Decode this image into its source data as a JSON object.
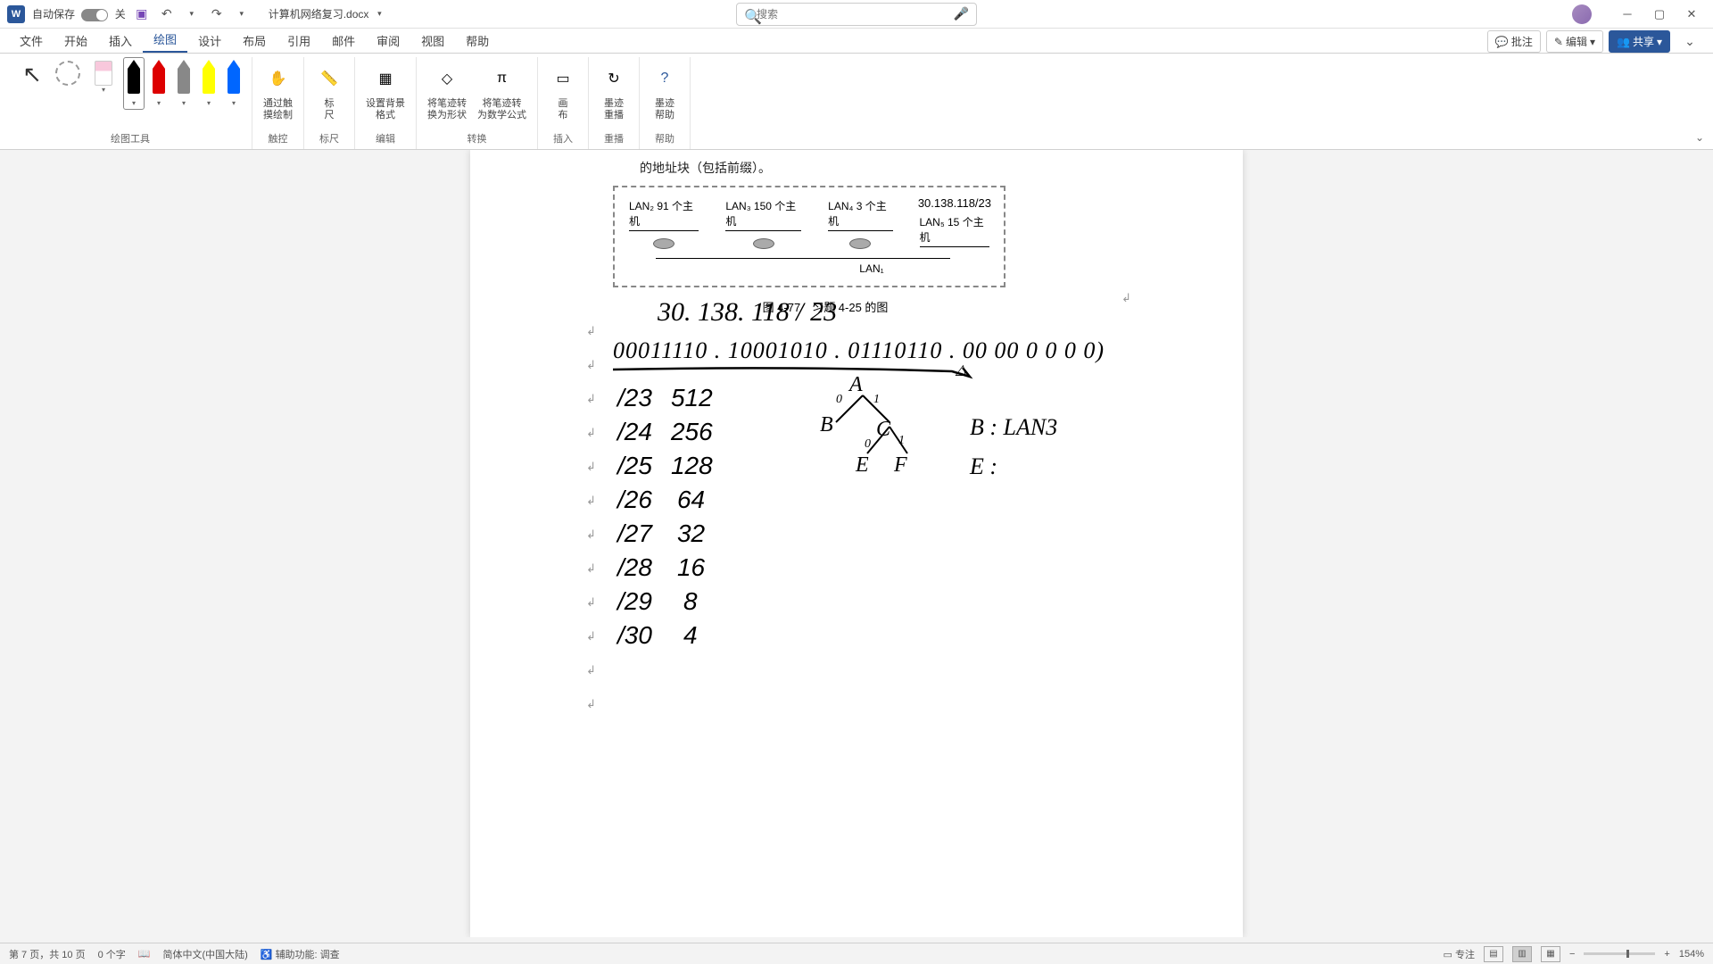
{
  "titlebar": {
    "autosave_label": "自动保存",
    "autosave_state": "关",
    "doc_title": "计算机网络复习.docx",
    "search_placeholder": "搜索"
  },
  "menu": {
    "tabs": [
      "文件",
      "开始",
      "插入",
      "绘图",
      "设计",
      "布局",
      "引用",
      "邮件",
      "审阅",
      "视图",
      "帮助"
    ],
    "active_index": 3,
    "comments": "批注",
    "edit": "编辑",
    "share": "共享"
  },
  "ribbon": {
    "groups": {
      "draw_tools": "绘图工具",
      "touch": "触控",
      "ruler_g": "标尺",
      "edit": "编辑",
      "convert": "转换",
      "insert": "插入",
      "replay": "重播",
      "help": "帮助"
    },
    "buttons": {
      "touch_draw": "通过触\n摸绘制",
      "ruler": "标\n尺",
      "ink_format": "设置背景\n格式",
      "ink_to_shape": "将笔迹转\n换为形状",
      "ink_to_math": "将笔迹转\n为数学公式",
      "canvas": "画\n布",
      "ink_replay": "墨迹\n重播",
      "ink_help": "墨迹\n帮助"
    }
  },
  "document": {
    "intro_text": "的地址块（包括前缀）。",
    "diagram": {
      "ip": "30.138.118/23",
      "lan2": "LAN₂ 91 个主机",
      "lan3": "LAN₃ 150 个主机",
      "lan4": "LAN₄ 3 个主机",
      "lan5": "LAN₅ 15 个主机",
      "lan1": "LAN₁"
    },
    "caption": "图 4-77　习题 4-25 的图",
    "handwriting": {
      "ip_line": "30. 138. 118 / 23",
      "binary": "00011110 . 10001010 . 01110110 . 00 00 0 0 0 0)",
      "prefix_rows": [
        {
          "p": "/23",
          "n": "512"
        },
        {
          "p": "/24",
          "n": "256"
        },
        {
          "p": "/25",
          "n": "128"
        },
        {
          "p": "/26",
          "n": "64"
        },
        {
          "p": "/27",
          "n": "32"
        },
        {
          "p": "/28",
          "n": "16"
        },
        {
          "p": "/29",
          "n": "8"
        },
        {
          "p": "/30",
          "n": "4"
        }
      ],
      "tree": {
        "A": "A",
        "B": "B",
        "C": "C",
        "E": "E",
        "F": "F",
        "zero": "0",
        "one": "1"
      },
      "notes": {
        "b_lan3": "B : LAN3",
        "e": "E :"
      }
    }
  },
  "statusbar": {
    "page": "第 7 页，共 10 页",
    "words": "0 个字",
    "lang": "简体中文(中国大陆)",
    "accessibility": "辅助功能: 调查",
    "focus": "专注",
    "zoom": "154%"
  }
}
